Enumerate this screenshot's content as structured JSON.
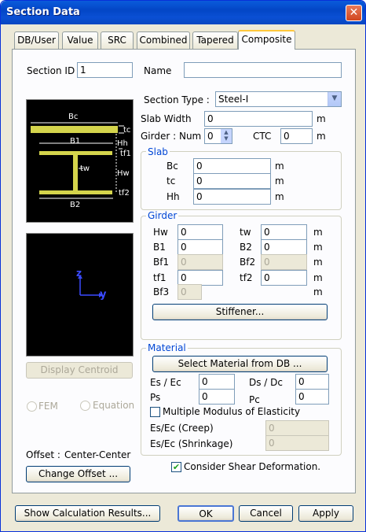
{
  "window": {
    "title": "Section Data",
    "close_glyph": "✕"
  },
  "tabs": [
    "DB/User",
    "Value",
    "SRC",
    "Combined",
    "Tapered",
    "Composite"
  ],
  "section_id": {
    "label": "Section ID",
    "value": "1"
  },
  "name": {
    "label": "Name",
    "value": ""
  },
  "section_type": {
    "label": "Section Type :",
    "value": "Steel-I"
  },
  "slab_width": {
    "label": "Slab Width",
    "value": "0",
    "unit": "m"
  },
  "girder_num": {
    "label": "Girder : Num",
    "value": "0"
  },
  "ctc": {
    "label": "CTC",
    "value": "0",
    "unit": "m"
  },
  "diagram": {
    "bc": "Bc",
    "tc": "tc",
    "b1": "B1",
    "hh": "Hh",
    "tf1": "tf1",
    "tw": "tw",
    "hw": "Hw",
    "tf2": "tf2",
    "b2": "B2"
  },
  "axes": {
    "z": "z",
    "y": "y"
  },
  "slab": {
    "title": "Slab",
    "rows": [
      {
        "label": "Bc",
        "value": "0",
        "unit": "m"
      },
      {
        "label": "tc",
        "value": "0",
        "unit": "m"
      },
      {
        "label": "Hh",
        "value": "0",
        "unit": "m"
      }
    ]
  },
  "girder": {
    "title": "Girder",
    "left": [
      {
        "label": "Hw",
        "value": "0",
        "disabled": false
      },
      {
        "label": "B1",
        "value": "0",
        "disabled": false
      },
      {
        "label": "Bf1",
        "value": "0",
        "disabled": true
      },
      {
        "label": "tf1",
        "value": "0",
        "disabled": false
      },
      {
        "label": "Bf3",
        "value": "0",
        "disabled": true
      }
    ],
    "right": [
      {
        "label": "tw",
        "value": "0",
        "disabled": false
      },
      {
        "label": "B2",
        "value": "0",
        "disabled": false
      },
      {
        "label": "Bf2",
        "value": "0",
        "disabled": true
      },
      {
        "label": "tf2",
        "value": "0",
        "disabled": false
      }
    ],
    "unit": "m",
    "stiffener": "Stiffener..."
  },
  "display_centroid": "Display Centroid",
  "fem": "FEM",
  "equation": "Equation",
  "offset": {
    "label": "Offset :",
    "value": "Center-Center",
    "button": "Change Offset ..."
  },
  "material": {
    "title": "Material",
    "select_btn": "Select Material from DB ...",
    "es_ec": {
      "label": "Es / Ec",
      "value": "0"
    },
    "ds_dc": {
      "label": "Ds / Dc",
      "value": "0"
    },
    "ps": {
      "label": "Ps",
      "value": "0"
    },
    "pc": {
      "label": "Pc",
      "value": "0"
    },
    "multiple": "Multiple Modulus of Elasticity",
    "creep": {
      "label": "Es/Ec (Creep)",
      "value": "0"
    },
    "shrink": {
      "label": "Es/Ec (Shrinkage)",
      "value": "0"
    }
  },
  "consider_shear": "Consider Shear Deformation.",
  "footer": {
    "calc": "Show Calculation Results...",
    "ok": "OK",
    "cancel": "Cancel",
    "apply": "Apply"
  },
  "colors": {
    "accent": "#0046d5",
    "steel": "#d4d44c"
  }
}
